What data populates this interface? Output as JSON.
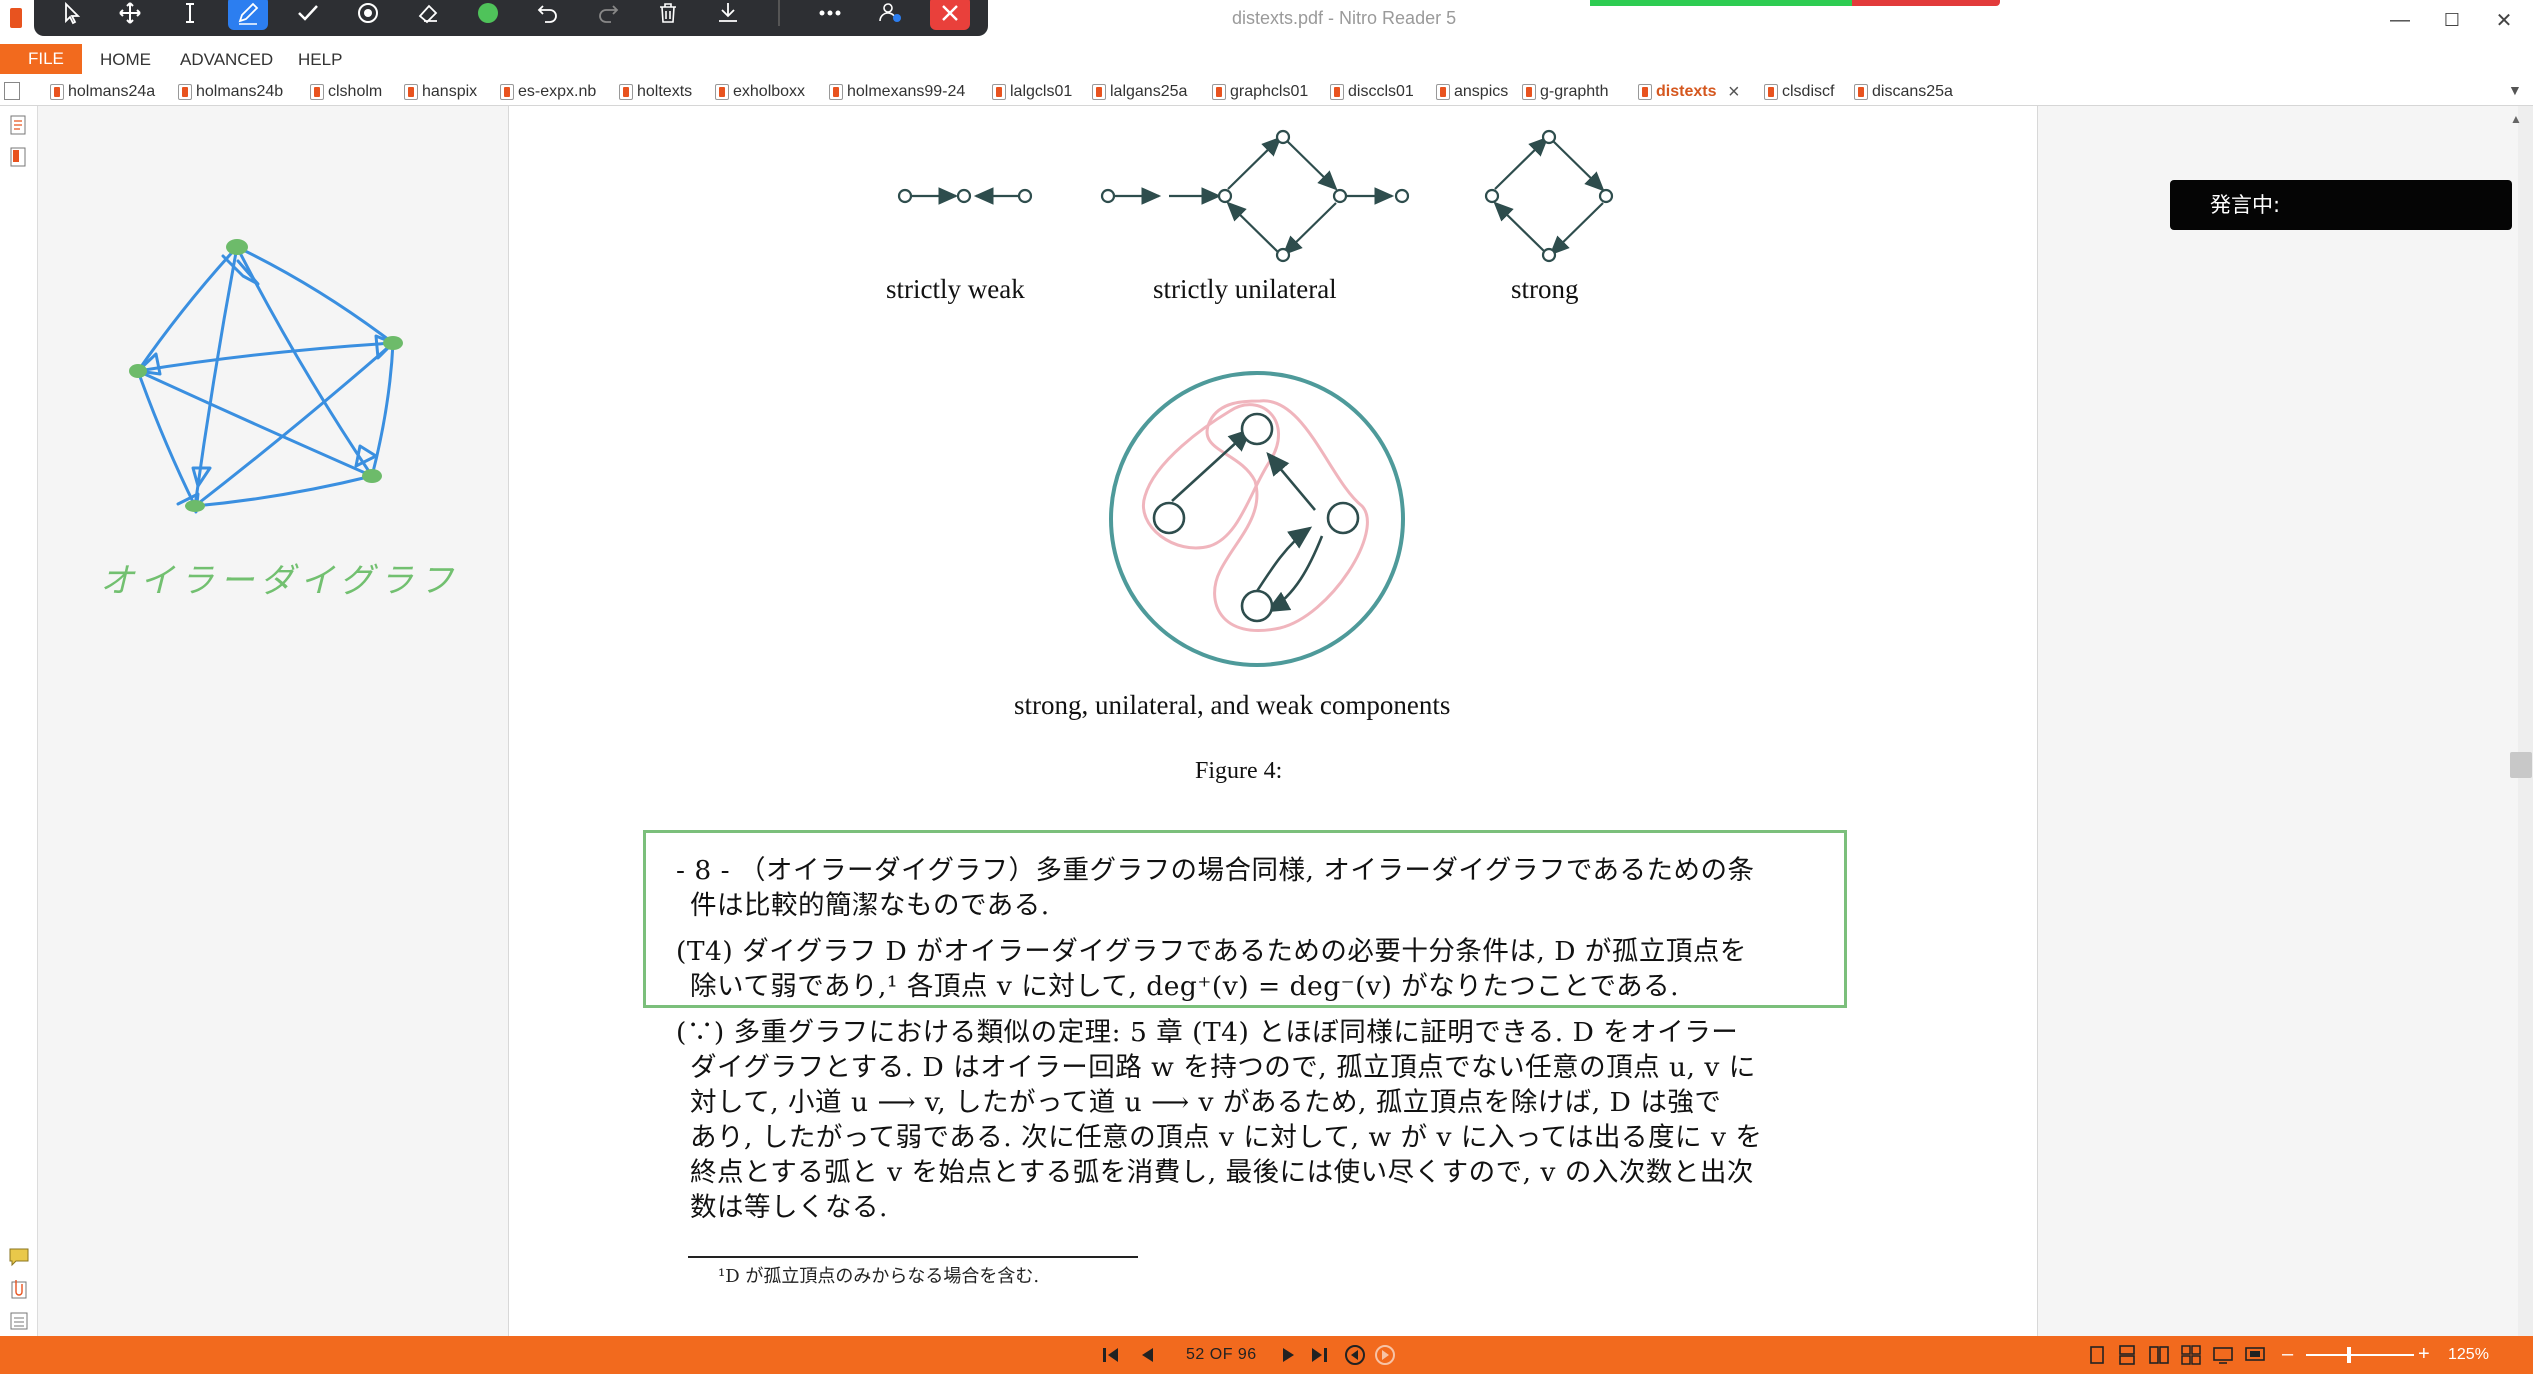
{
  "window": {
    "title": "distexts.pdf - Nitro Reader 5",
    "minimize": "—",
    "maximize": "☐",
    "close": "✕"
  },
  "menu": {
    "file": "FILE",
    "home": "HOME",
    "advanced": "ADVANCED",
    "help": "HELP"
  },
  "tabs": [
    "holmans24a",
    "holmans24b",
    "clsholm",
    "hanspix",
    "es-expx.nb",
    "holtexts",
    "exholboxx",
    "holmexans99-24",
    "lalgcls01",
    "lalgans25a",
    "graphcls01",
    "disccls01",
    "anspics",
    "g-graphth",
    "distexts",
    "clsdiscf",
    "discans25a"
  ],
  "active_tab": "distexts",
  "annotation": {
    "handwriting_text": "オイラーダイグラフ",
    "ink_color": "#3a8fe0",
    "vertex_color": "#6dbb6a",
    "text_color": "#72c070"
  },
  "speaking": {
    "label": "発言中:"
  },
  "figure": {
    "label_weak": "strictly weak",
    "label_unilateral": "strictly unilateral",
    "label_strong": "strong",
    "label_components": "strong, unilateral, and weak components",
    "caption": "Figure 4:",
    "stroke_color": "#2e4d4d",
    "outer_circle_color": "#4e9a9a",
    "component_color": "#f0b5bd"
  },
  "body_text": {
    "box_line1": "- 8 - （オイラーダイグラフ）多重グラフの場合同様, オイラーダイグラフであるための条",
    "box_line2": "件は比較的簡潔なものである.",
    "box_line3": "(T4)  ダイグラフ D がオイラーダイグラフであるための必要十分条件は, D が孤立頂点を",
    "box_line4": "除いて弱であり,¹ 各頂点 v に対して, deg⁺(v) = deg⁻(v) がなりたつことである.",
    "proof_line1": "(∵) 多重グラフにおける類似の定理: 5 章 (T4) とほぼ同様に証明できる. D をオイラー",
    "proof_line2": "ダイグラフとする. D はオイラー回路 w を持つので, 孤立頂点でない任意の頂点 u, v に",
    "proof_line3": "対して, 小道 u ⟶ v, したがって道 u ⟶ v があるため, 孤立頂点を除けば, D は強で",
    "proof_line4": "あり, したがって弱である. 次に任意の頂点 v に対して, w が v に入っては出る度に v を",
    "proof_line5": "終点とする弧と v を始点とする弧を消費し, 最後には使い尽くすので, v の入次数と出次",
    "proof_line6": "数は等しくなる.",
    "footnote": "¹D が孤立頂点のみからなる場合を含む."
  },
  "status": {
    "page_indicator": "52 OF 96",
    "zoom": "125%",
    "zoom_fraction": 0.4,
    "minus": "–",
    "plus": "+"
  },
  "colors": {
    "accent": "#f26a1e",
    "pen_active": "#2c7ef0",
    "close_red": "#e9403b",
    "theorem_border": "#7bbf7b"
  }
}
